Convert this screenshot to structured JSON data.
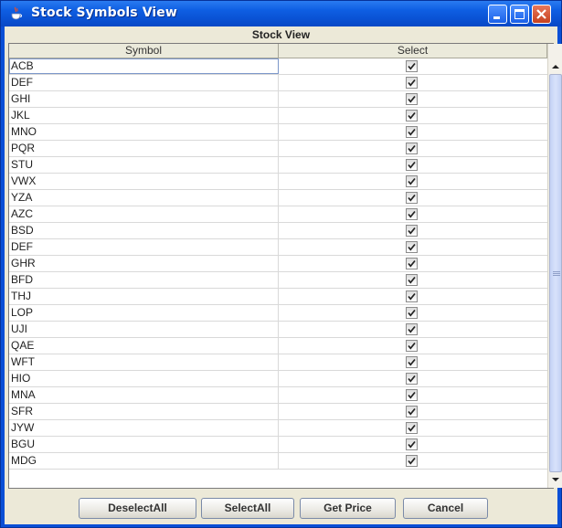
{
  "window": {
    "title": "Stock Symbols View",
    "icon": "java-coffee-cup-icon",
    "controls": [
      "minimize",
      "maximize",
      "close"
    ]
  },
  "panel": {
    "caption": "Stock View"
  },
  "table": {
    "columns": [
      "Symbol",
      "Select"
    ],
    "rows": [
      {
        "symbol": "ACB",
        "selected": true
      },
      {
        "symbol": "DEF",
        "selected": true
      },
      {
        "symbol": "GHI",
        "selected": true
      },
      {
        "symbol": "JKL",
        "selected": true
      },
      {
        "symbol": "MNO",
        "selected": true
      },
      {
        "symbol": "PQR",
        "selected": true
      },
      {
        "symbol": "STU",
        "selected": true
      },
      {
        "symbol": "VWX",
        "selected": true
      },
      {
        "symbol": "YZA",
        "selected": true
      },
      {
        "symbol": "AZC",
        "selected": true
      },
      {
        "symbol": "BSD",
        "selected": true
      },
      {
        "symbol": "DEF",
        "selected": true
      },
      {
        "symbol": "GHR",
        "selected": true
      },
      {
        "symbol": "BFD",
        "selected": true
      },
      {
        "symbol": "THJ",
        "selected": true
      },
      {
        "symbol": "LOP",
        "selected": true
      },
      {
        "symbol": "UJI",
        "selected": true
      },
      {
        "symbol": "QAE",
        "selected": true
      },
      {
        "symbol": "WFT",
        "selected": true
      },
      {
        "symbol": "HIO",
        "selected": true
      },
      {
        "symbol": "MNA",
        "selected": true
      },
      {
        "symbol": "SFR",
        "selected": true
      },
      {
        "symbol": "JYW",
        "selected": true
      },
      {
        "symbol": "BGU",
        "selected": true
      },
      {
        "symbol": "MDG",
        "selected": true
      }
    ]
  },
  "buttons": {
    "deselect_all": "DeselectAll",
    "select_all": "SelectAll",
    "get_price": "Get Price",
    "cancel": "Cancel"
  },
  "colors": {
    "titlebar": "#0a52d4",
    "panel": "#ece9d8",
    "close_button": "#c6411f"
  }
}
